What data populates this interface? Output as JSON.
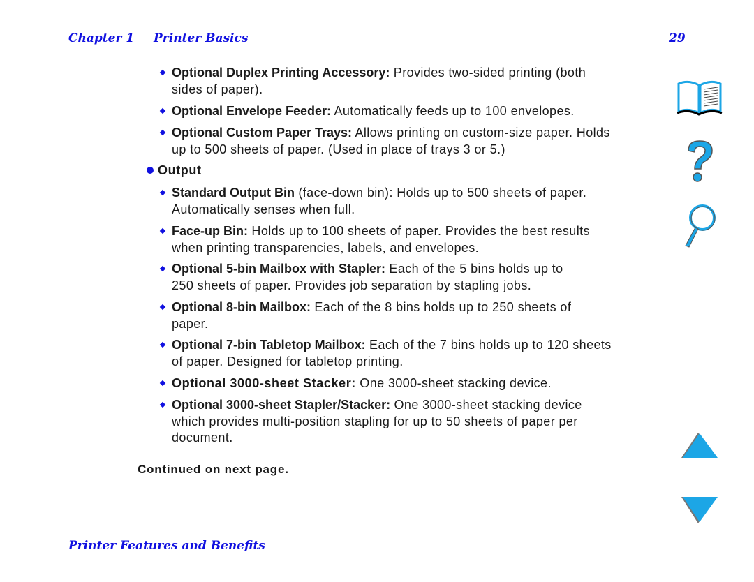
{
  "header": {
    "chapter": "Chapter 1",
    "chapter_title": "Printer Basics",
    "page_number": "29"
  },
  "footer": {
    "section_title": "Printer Features and Benefits"
  },
  "accessories": [
    {
      "title": "Optional Duplex Printing Accessory:",
      "lines": [
        " Provides two-sided printing (both",
        "sides of paper)."
      ]
    },
    {
      "title": "Optional Envelope Feeder:",
      "lines": [
        " Automatically feeds up to 100 envelopes."
      ]
    },
    {
      "title": "Optional Custom Paper Trays:",
      "lines": [
        " Allows printing on custom-size paper. Holds",
        "up to 500 sheets of paper. (Used in place of trays 3 or 5.)"
      ]
    }
  ],
  "output_section": {
    "label": "Output"
  },
  "output_items": [
    {
      "title": "Standard Output Bin",
      "lines": [
        " (face-down bin): Holds up to 500 sheets of paper.",
        "Automatically senses when full."
      ]
    },
    {
      "title": "Face-up Bin:",
      "lines": [
        " Holds up to 100 sheets of paper. Provides the best results",
        "when printing transparencies, labels, and envelopes."
      ]
    },
    {
      "title": "Optional 5-bin Mailbox with Stapler:",
      "lines": [
        " Each of the 5 bins holds up to",
        "250 sheets of paper. Provides job separation by stapling jobs."
      ]
    },
    {
      "title": "Optional 8-bin Mailbox:",
      "lines": [
        " Each of the 8 bins holds up to 250 sheets of",
        "paper."
      ]
    },
    {
      "title": "Optional 7-bin Tabletop Mailbox:",
      "lines": [
        " Each of the 7 bins holds up to 120 sheets",
        "of paper. Designed for tabletop printing."
      ]
    },
    {
      "title": "Optional 3000-sheet Stacker:",
      "lines": [
        " One 3000-sheet stacking device."
      ]
    },
    {
      "title": "Optional 3000-sheet Stapler/Stacker:",
      "lines": [
        " One 3000-sheet stacking device",
        "which provides multi-position stapling for up to 50 sheets of paper per",
        "document."
      ]
    }
  ],
  "continued_text": "Continued on next page.",
  "nav_icons": [
    "book-icon",
    "help-icon",
    "search-icon",
    "previous-page-icon",
    "next-page-icon"
  ],
  "colors": {
    "heading_blue": "#1010e0",
    "icon_cyan": "#1ca6e6"
  }
}
